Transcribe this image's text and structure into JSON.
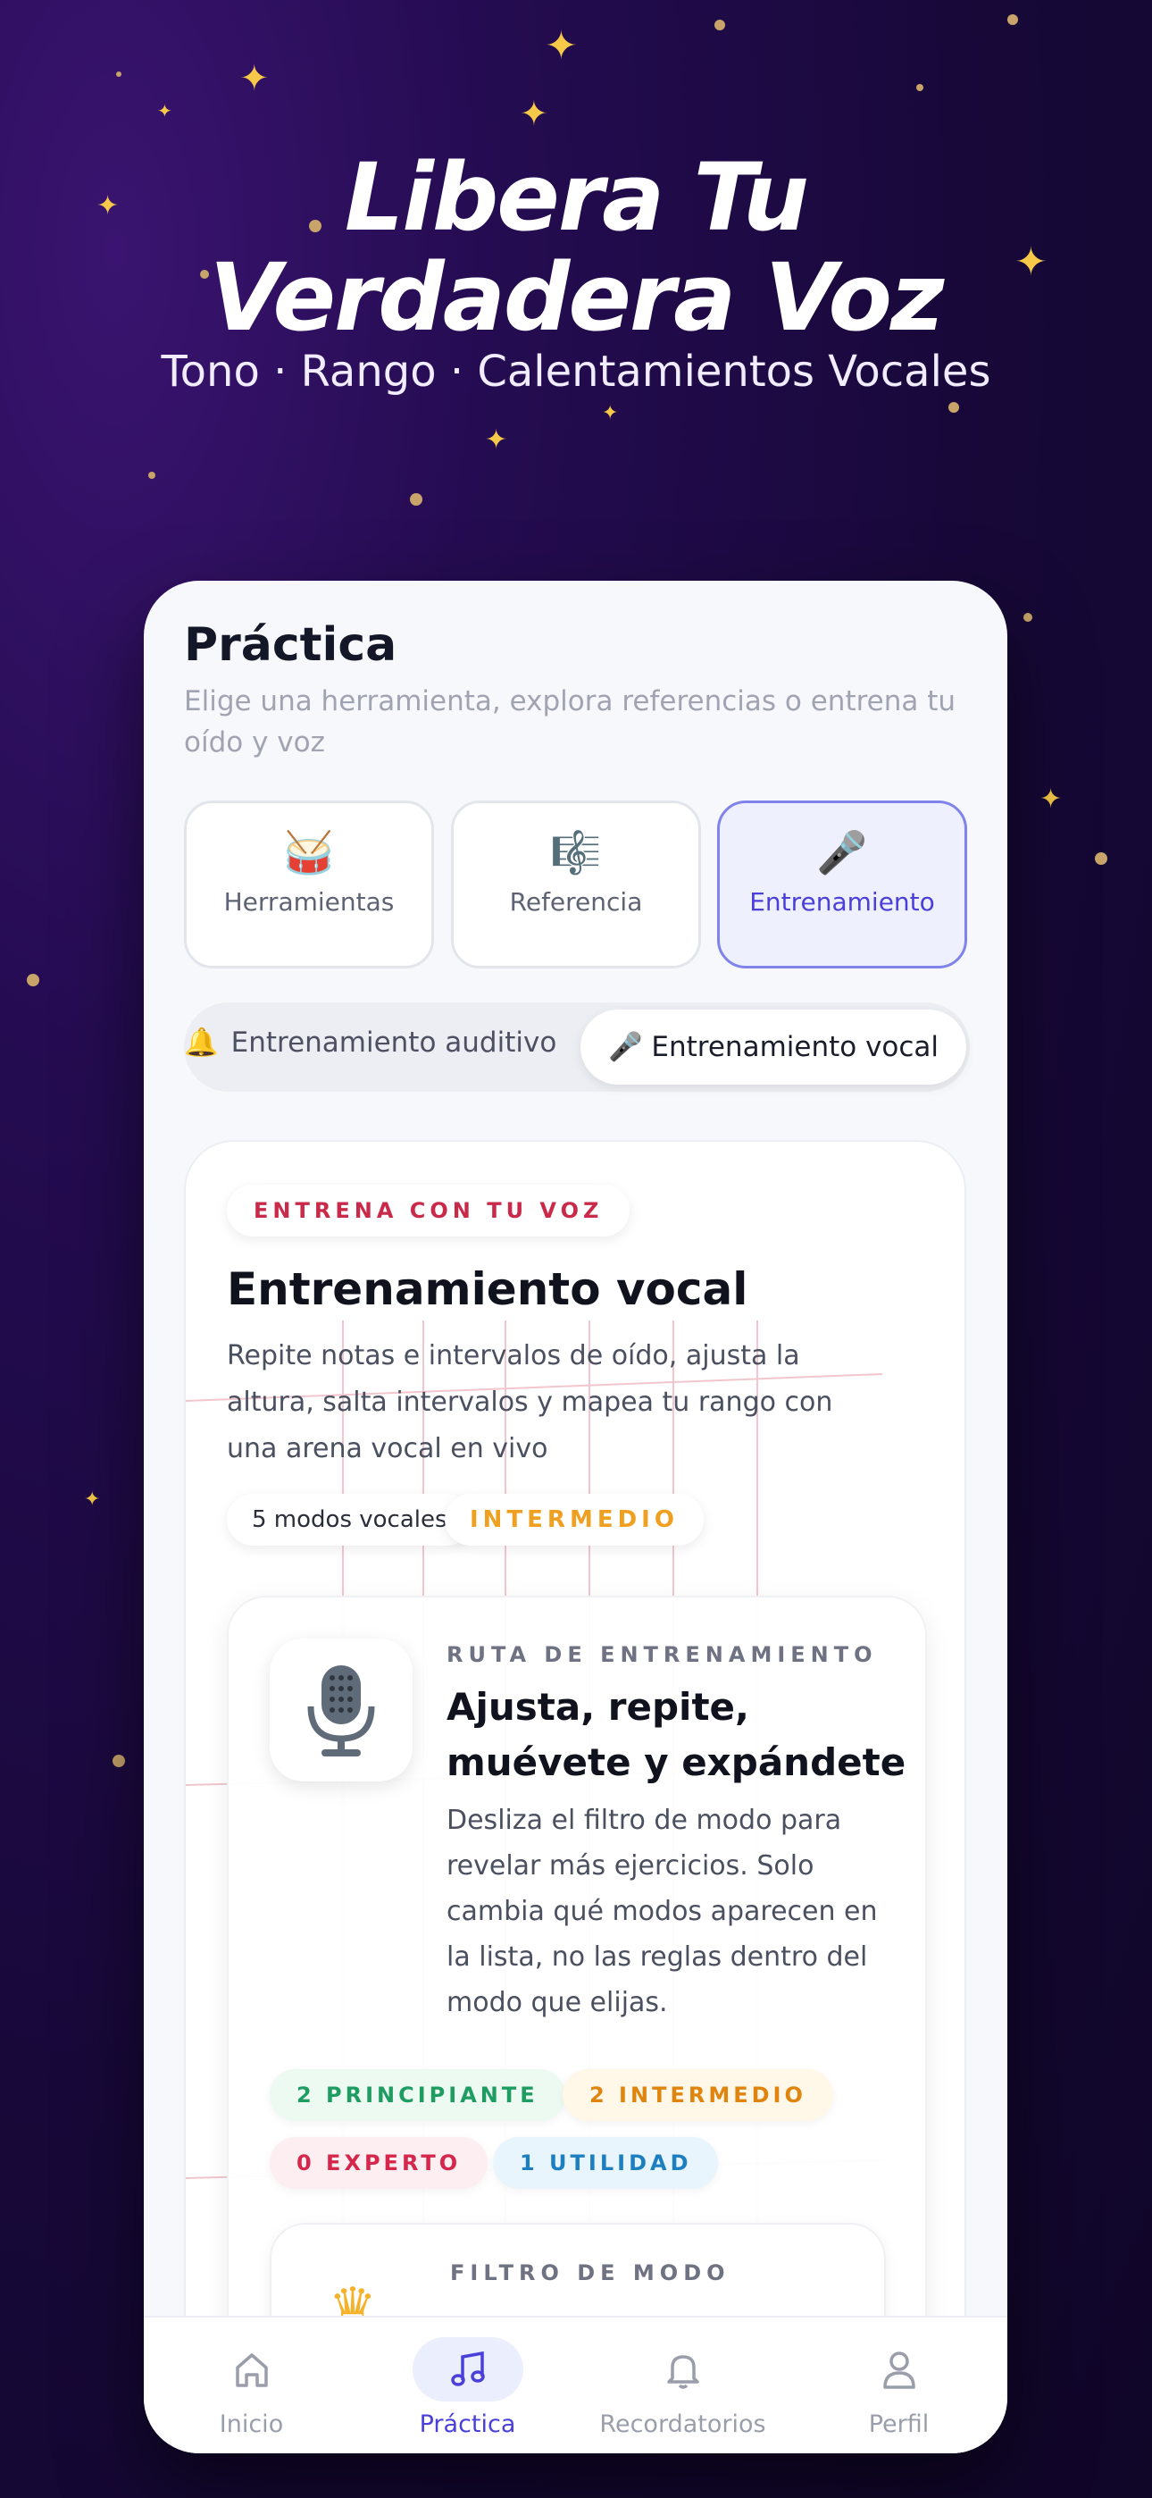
{
  "hero": {
    "title_line1": "Libera Tu",
    "title_line2": "Verdadera Voz",
    "subtitle": "Tono · Rango · Calentamientos Vocales"
  },
  "screen": {
    "title": "Práctica",
    "description": "Elige una herramienta, explora referencias o entrena tu oído y voz",
    "segments": [
      {
        "label": "Herramientas",
        "icon": "drum-icon",
        "emoji": "🥁",
        "active": false
      },
      {
        "label": "Referencia",
        "icon": "sheet-music-icon",
        "emoji": "🎼",
        "active": false
      },
      {
        "label": "Entrenamiento",
        "icon": "microphone-notes-icon",
        "emoji": "🎤",
        "active": true
      }
    ],
    "subtabs": {
      "left": "Entrenamiento auditivo",
      "right": "Entrenamiento vocal",
      "selected": "Entrenamiento vocal"
    }
  },
  "card": {
    "eyebrow": "ENTRENA CON TU VOZ",
    "title": "Entrenamiento vocal",
    "description": "Repite notas e intervalos de oído, ajusta la altura, salta intervalos y mapea tu rango con una arena vocal en vivo",
    "chips": [
      "5 modos vocales",
      "INTERMEDIO"
    ],
    "path": {
      "label": "RUTA DE ENTRENAMIENTO",
      "title": "Ajusta, repite, muévete y expándete",
      "description": "Desliza el filtro de modo para revelar más ejercicios. Solo cambia qué modos aparecen en la lista, no las reglas dentro del modo que elijas."
    },
    "levels": [
      {
        "label": "2 PRINCIPIANTE",
        "color": "#1e9c62"
      },
      {
        "label": "2 INTERMEDIO",
        "color": "#e08410"
      },
      {
        "label": "0 EXPERTO",
        "color": "#d5264c"
      },
      {
        "label": "1 UTILIDAD",
        "color": "#1d7fc0"
      }
    ],
    "mode_filter_label": "FILTRO DE MODO"
  },
  "nav": {
    "items": [
      {
        "label": "Inicio",
        "icon": "home-icon"
      },
      {
        "label": "Práctica",
        "icon": "music-note-icon"
      },
      {
        "label": "Recordatorios",
        "icon": "bell-icon"
      },
      {
        "label": "Perfil",
        "icon": "user-icon"
      }
    ],
    "active": "Práctica"
  },
  "colors": {
    "background": "#170838",
    "accent": "#4a3fd9",
    "star": "#f7c948"
  }
}
